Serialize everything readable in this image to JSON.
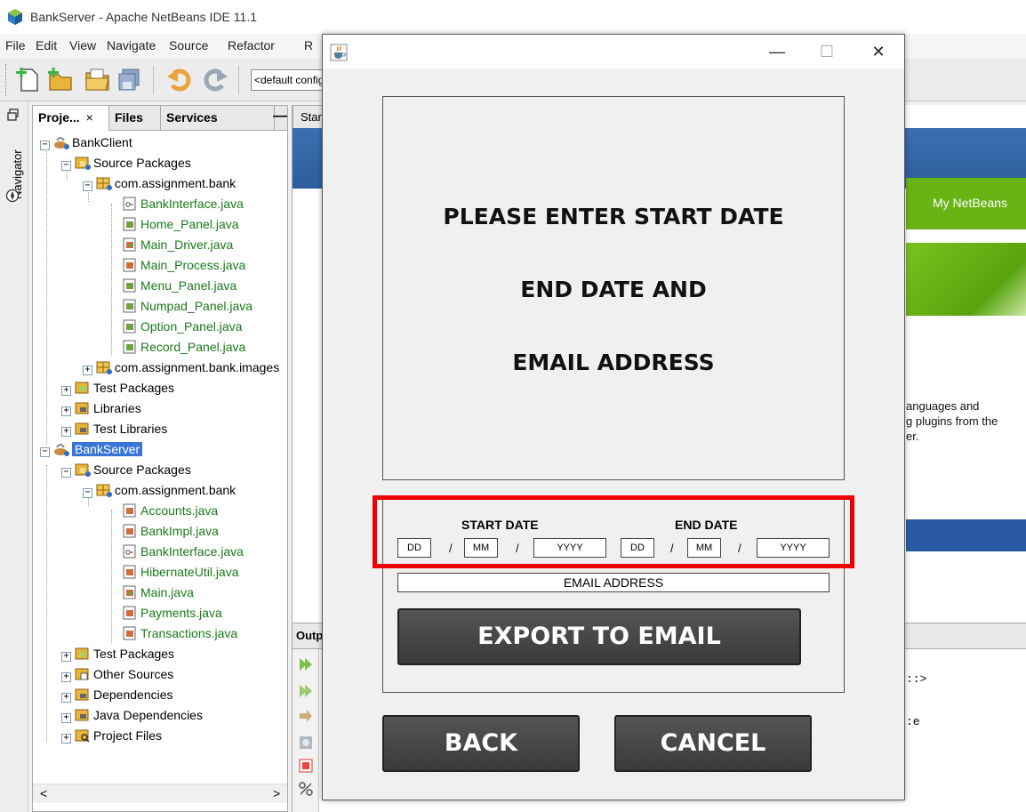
{
  "ide": {
    "title": "BankServer - Apache NetBeans IDE 11.1",
    "menu": [
      "File",
      "Edit",
      "View",
      "Navigate",
      "Source",
      "Refactor",
      "R"
    ],
    "config_select": "<default config>",
    "left_strip_label": "Navigator"
  },
  "projects_panel": {
    "tabs": {
      "projects": "Proje...",
      "files": "Files",
      "services": "Services",
      "close": "×",
      "minimize": "—"
    },
    "tree": {
      "bank_client": "BankClient",
      "client_source_packages": "Source Packages",
      "client_package": "com.assignment.bank",
      "client_files": [
        "BankInterface.java",
        "Home_Panel.java",
        "Main_Driver.java",
        "Main_Process.java",
        "Menu_Panel.java",
        "Numpad_Panel.java",
        "Option_Panel.java",
        "Record_Panel.java"
      ],
      "client_images_package": "com.assignment.bank.images",
      "client_test_packages": "Test Packages",
      "client_libraries": "Libraries",
      "client_test_libraries": "Test Libraries",
      "bank_server": "BankServer",
      "server_source_packages": "Source Packages",
      "server_package": "com.assignment.bank",
      "server_files": [
        "Accounts.java",
        "BankImpl.java",
        "BankInterface.java",
        "HibernateUtil.java",
        "Main.java",
        "Payments.java",
        "Transactions.java"
      ],
      "server_test_packages": "Test Packages",
      "server_other_sources": "Other Sources",
      "server_dependencies": "Dependencies",
      "server_java_dependencies": "Java Dependencies",
      "server_project_files": "Project Files"
    },
    "scroll_left": "<",
    "scroll_right": ">"
  },
  "editor": {
    "start_tab": "Star",
    "my_netbeans": "My NetBeans",
    "start_text_lines": [
      "anguages and",
      "g plugins from the",
      "er."
    ],
    "output_tab": "Outp",
    "output_text_1": "::>",
    "output_text_2": ":e"
  },
  "dialog": {
    "controls": {
      "minimize": "—",
      "maximize": "☐",
      "close": "✕"
    },
    "message_lines": [
      "PLEASE ENTER START DATE",
      "END DATE AND",
      "EMAIL ADDRESS"
    ],
    "start_date_label": "START DATE",
    "end_date_label": "END DATE",
    "slash": "/",
    "start_dd": "DD",
    "start_mm": "MM",
    "start_yyyy": "YYYY",
    "end_dd": "DD",
    "end_mm": "MM",
    "end_yyyy": "YYYY",
    "email_placeholder": "EMAIL ADDRESS",
    "export_button": "EXPORT TO EMAIL",
    "back_button": "BACK",
    "cancel_button": "CANCEL"
  },
  "colors": {
    "highlight": "#ee0000",
    "tree_file_text": "#1a7a1a",
    "selection": "#3875d7",
    "button_dark": "#444444"
  }
}
